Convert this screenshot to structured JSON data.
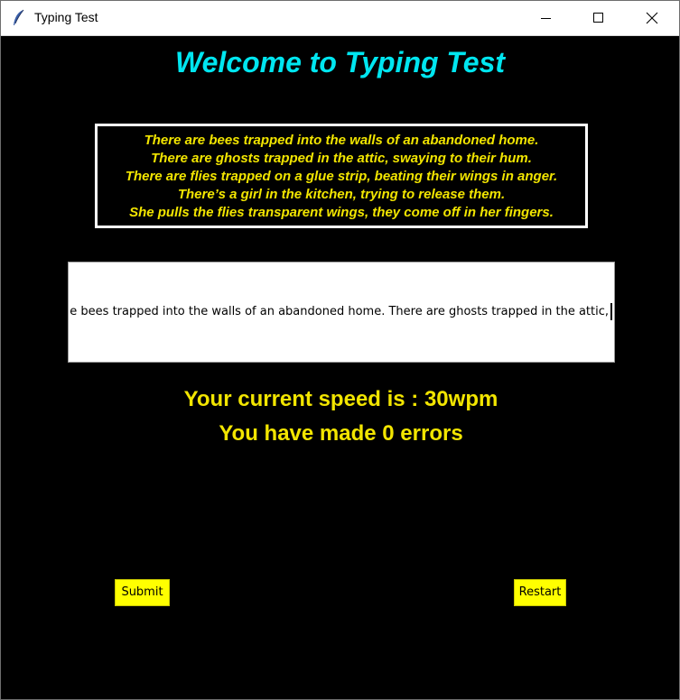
{
  "window": {
    "title": "Typing Test",
    "icon": "feather-icon"
  },
  "heading": "Welcome to Typing Test",
  "passage": {
    "lines": [
      "There are bees trapped into the walls of an abandoned home.",
      "There are ghosts trapped in the attic, swaying to their hum.",
      "There are flies trapped on a glue strip, beating their wings in anger.",
      "There’s a girl in the kitchen, trying to release them.",
      "She pulls the flies transparent wings, they come off in her fingers."
    ]
  },
  "entry": {
    "value": "e bees trapped into the walls of an abandoned home. There are ghosts trapped in the attic,"
  },
  "stats": {
    "speed_text": "Your current speed is : 30wpm",
    "errors_text": "You have made 0 errors"
  },
  "buttons": {
    "submit_label": "Submit",
    "restart_label": "Restart"
  },
  "colors": {
    "background": "#000000",
    "heading": "#00e6f0",
    "text": "#f2e500",
    "button": "#ffff00"
  }
}
